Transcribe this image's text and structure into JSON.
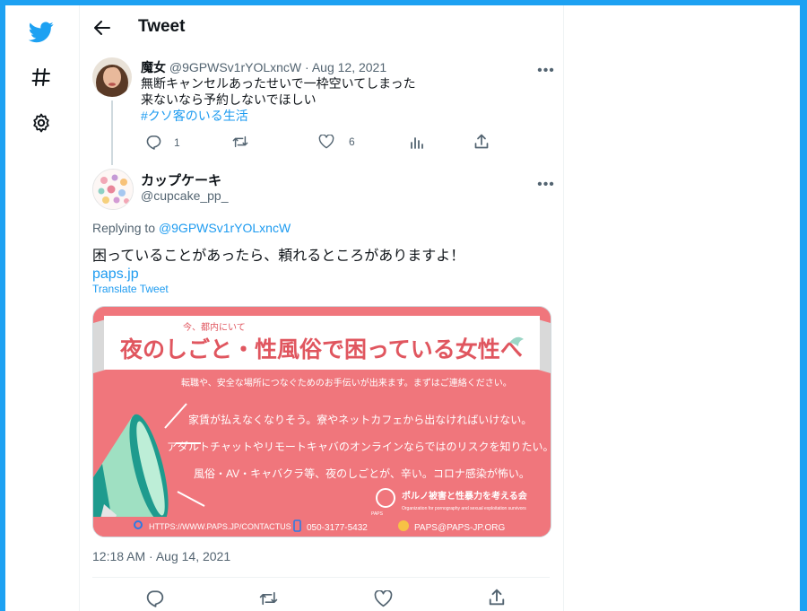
{
  "header": {
    "title": "Tweet"
  },
  "nav": {
    "icons": [
      "twitter-logo-icon",
      "hashtag-icon",
      "gear-icon"
    ]
  },
  "tweet1": {
    "name": "魔女",
    "handle": "@9GPWSv1rYOLxncW",
    "date": "Aug 12, 2021",
    "lines": [
      "無断キャンセルあったせいで一枠空いてしまった",
      "来ないなら予約しないでほしい"
    ],
    "hashtag": "#クソ客のいる生活",
    "replies": "1",
    "likes": "6"
  },
  "tweet2": {
    "name": "カップケーキ",
    "handle": "@cupcake_pp_",
    "replying_label": "Replying to",
    "replying_to": "@9GPWSv1rYOLxncW",
    "text": "困っていることがあったら、頼れるところがありますよ！",
    "link": "paps.jp",
    "translate": "Translate Tweet",
    "timestamp": "12:18 AM · Aug 14, 2021",
    "image": {
      "top_small": "今、都内にいて",
      "banner": "夜のしごと・性風俗で困っている女性へ",
      "sub": "転職や、安全な場所につなぐためのお手伝いが出来ます。まずはご連絡ください。",
      "line1": "家賃が払えなくなりそう。寮やネットカフェから出なければいけない。",
      "line2": "アダルトチャットやリモートキャバのオンラインならではのリスクを知りたい。",
      "line3": "風俗・AV・キャバクラ等、夜のしごとが、辛い。コロナ感染が怖い。",
      "org_jp": "ポルノ被害と性暴力を考える会",
      "org_en1": "Organization for pornography and sexual exploitation survivors",
      "org_short": "PAPS",
      "contact_url": "HTTPS://WWW.PAPS.JP/CONTACTUS",
      "phone": "050-3177-5432",
      "email": "PAPS@PAPS-JP.ORG",
      "bg_color": "#f0767c"
    }
  },
  "colors": {
    "accent": "#1d9bf0",
    "frame": "#1da1f2",
    "muted": "#536471"
  }
}
